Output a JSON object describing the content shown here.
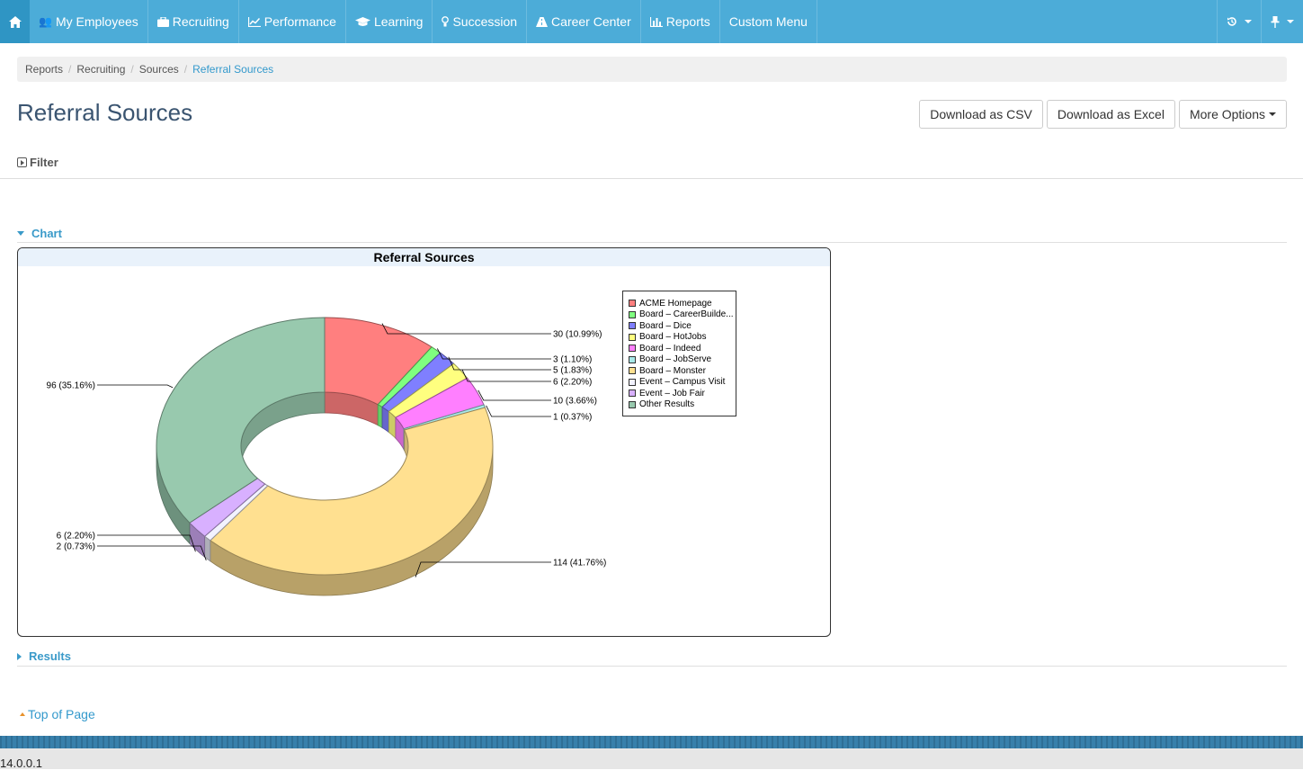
{
  "nav": {
    "items": [
      {
        "label": "My Employees",
        "icon": "users-icon"
      },
      {
        "label": "Recruiting",
        "icon": "briefcase-icon"
      },
      {
        "label": "Performance",
        "icon": "line-chart-icon"
      },
      {
        "label": "Learning",
        "icon": "graduation-cap-icon"
      },
      {
        "label": "Succession",
        "icon": "lightbulb-icon"
      },
      {
        "label": "Career Center",
        "icon": "road-icon"
      },
      {
        "label": "Reports",
        "icon": "bar-chart-icon"
      },
      {
        "label": "Custom Menu",
        "icon": ""
      }
    ]
  },
  "breadcrumb": [
    "Reports",
    "Recruiting",
    "Sources",
    "Referral Sources"
  ],
  "page": {
    "title": "Referral Sources",
    "buttons": {
      "csv": "Download as CSV",
      "excel": "Download as Excel",
      "more": "More Options"
    },
    "filter_label": "Filter",
    "chart_section": "Chart",
    "results_section": "Results",
    "top_link": "Top of Page"
  },
  "footer": {
    "version": "14.0.0.1"
  },
  "colors": {
    "nav": "#4cacd8",
    "nav_home": "#2f95c4",
    "accent": "#3399cc",
    "title": "#3a5470"
  },
  "chart_data": {
    "type": "pie",
    "style": "3d-donut",
    "title": "Referral Sources",
    "legend_position": "right",
    "slices": [
      {
        "label": "ACME Homepage",
        "value": 30,
        "text": "30 (10.99%)",
        "color": "#ff7f7f"
      },
      {
        "label": "Board - CareerBuilde...",
        "value": 3,
        "text": "3 (1.10%)",
        "color": "#7fff7f"
      },
      {
        "label": "Board - Dice",
        "value": 5,
        "text": "5 (1.83%)",
        "color": "#7f7fff"
      },
      {
        "label": "Board - HotJobs",
        "value": 6,
        "text": "6 (2.20%)",
        "color": "#ffff7f"
      },
      {
        "label": "Board - Indeed",
        "value": 10,
        "text": "10 (3.66%)",
        "color": "#ff7fff"
      },
      {
        "label": "Board - JobServe",
        "value": 1,
        "text": "1 (0.37%)",
        "color": "#a8e8e8"
      },
      {
        "label": "Board - Monster",
        "value": 114,
        "text": "114 (41.76%)",
        "color": "#ffe090"
      },
      {
        "label": "Event - Campus Visit",
        "value": 2,
        "text": "2 (0.73%)",
        "color": "#f2f2ff"
      },
      {
        "label": "Event - Job Fair",
        "value": 6,
        "text": "6 (2.20%)",
        "color": "#d8b0ff"
      },
      {
        "label": "Other Results",
        "value": 96,
        "text": "96 (35.16%)",
        "color": "#98c9ae"
      }
    ]
  }
}
